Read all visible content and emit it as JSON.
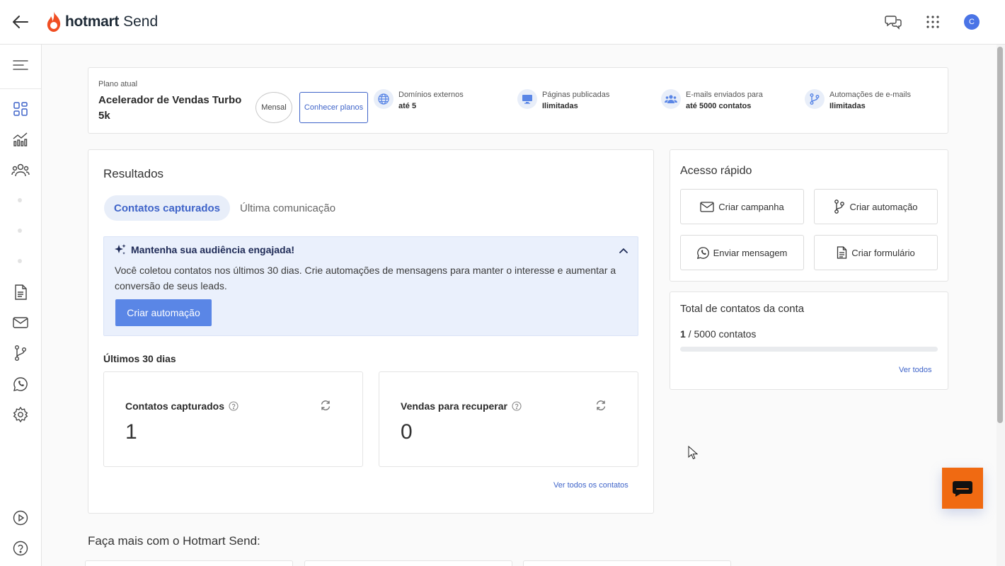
{
  "header": {
    "brand": "hotmart",
    "product": "Send",
    "avatar_initial": "C",
    "brand_color": "#f04e23",
    "accent_color": "#3f64c9"
  },
  "sidebar": {
    "icons": [
      "menu-icon",
      "dashboard-icon",
      "analytics-icon",
      "contacts-icon",
      "pages-icon",
      "email-icon",
      "automation-icon",
      "whatsapp-icon",
      "settings-icon",
      "play-icon",
      "help-icon"
    ]
  },
  "plan": {
    "label": "Plano atual",
    "name": "Acelerador de Vendas Turbo 5k",
    "billing": "Mensal",
    "cta": "Conhecer planos",
    "features": [
      {
        "title": "Domínios externos",
        "value": "até 5",
        "icon": "globe-icon"
      },
      {
        "title": "Páginas publicadas",
        "value": "Ilimitadas",
        "icon": "monitor-icon"
      },
      {
        "title": "E-mails enviados para",
        "value": "até 5000 contatos",
        "icon": "people-icon"
      },
      {
        "title": "Automações de e-mails",
        "value": "Ilimitadas",
        "icon": "branch-icon"
      }
    ]
  },
  "results": {
    "title": "Resultados",
    "tabs": [
      {
        "label": "Contatos capturados",
        "active": true
      },
      {
        "label": "Última comunicação",
        "active": false
      }
    ],
    "banner": {
      "title": "Mantenha sua audiência engajada!",
      "text": "Você coletou contatos nos últimos 30 dias. Crie automações de mensagens para manter o interesse e aumentar a conversão de seus leads.",
      "button": "Criar automação"
    },
    "period_label": "Últimos 30 dias",
    "metrics": [
      {
        "label": "Contatos capturados",
        "value": "1"
      },
      {
        "label": "Vendas para recuperar",
        "value": "0"
      }
    ],
    "see_all": "Ver todos os contatos"
  },
  "quick_access": {
    "title": "Acesso rápido",
    "buttons": [
      {
        "label": "Criar campanha",
        "icon": "mail-icon"
      },
      {
        "label": "Criar automação",
        "icon": "branch-icon"
      },
      {
        "label": "Enviar mensagem",
        "icon": "whatsapp-icon"
      },
      {
        "label": "Criar formulário",
        "icon": "form-icon"
      }
    ]
  },
  "total_contacts": {
    "title": "Total de contatos da conta",
    "current": "1",
    "limit_text": " / 5000 contatos",
    "progress_fraction": 0.0002,
    "see_all": "Ver todos"
  },
  "more": {
    "title": "Faça mais com o Hotmart Send:"
  }
}
